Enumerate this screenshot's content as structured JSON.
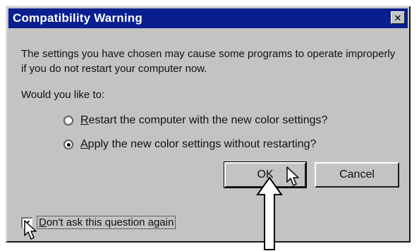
{
  "dialog": {
    "title": "Compatibility Warning",
    "close_glyph": "✕",
    "message": "The settings you have chosen may cause some programs to operate improperly if you do not restart your computer now.",
    "question": "Would you like to:"
  },
  "options": [
    {
      "mnemonic": "R",
      "rest": "estart the computer with the new color settings?",
      "selected": false
    },
    {
      "mnemonic": "A",
      "rest": "pply the new color settings without restarting?",
      "selected": true
    }
  ],
  "buttons": {
    "ok_label": "OK",
    "cancel_label": "Cancel"
  },
  "checkbox": {
    "mnemonic": "D",
    "rest": "on't ask this question again",
    "checked": true,
    "check_glyph": "✔"
  },
  "colors": {
    "titlebar": "#0a1f8f",
    "face": "#c3c3c3"
  },
  "icons": {
    "cursor_ok": "mouse-pointer-icon",
    "cursor_checkbox": "mouse-pointer-icon",
    "annotation": "up-arrow-icon"
  }
}
